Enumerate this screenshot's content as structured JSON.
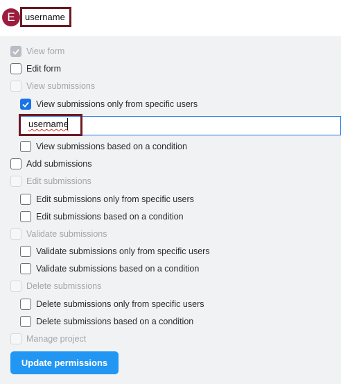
{
  "header": {
    "avatar_letter": "E",
    "user_label": "username"
  },
  "permissions": [
    {
      "label": "View form",
      "state": "checked-disabled"
    },
    {
      "label": "Edit form",
      "state": "unchecked"
    },
    {
      "label": "View submissions",
      "state": "disabled"
    },
    {
      "label": "View submissions only from specific users",
      "state": "checked"
    },
    {
      "label": "View submissions based on a condition",
      "state": "unchecked"
    },
    {
      "label": "Add submissions",
      "state": "unchecked"
    },
    {
      "label": "Edit submissions",
      "state": "disabled"
    },
    {
      "label": "Edit submissions only from specific users",
      "state": "unchecked"
    },
    {
      "label": "Edit submissions based on a condition",
      "state": "unchecked"
    },
    {
      "label": "Validate submissions",
      "state": "disabled"
    },
    {
      "label": "Validate submissions only from specific users",
      "state": "unchecked"
    },
    {
      "label": "Validate submissions based on a condition",
      "state": "unchecked"
    },
    {
      "label": "Delete submissions",
      "state": "disabled"
    },
    {
      "label": "Delete submissions only from specific users",
      "state": "unchecked"
    },
    {
      "label": "Delete submissions based on a condition",
      "state": "unchecked"
    },
    {
      "label": "Manage project",
      "state": "disabled"
    }
  ],
  "users_input": {
    "value": "username"
  },
  "submit": {
    "label": "Update permissions"
  },
  "colors": {
    "accent": "#2196f3",
    "checkbox_checked": "#1a73e8",
    "highlight_border": "#6b1a24",
    "badge": "#9b1c3d"
  }
}
